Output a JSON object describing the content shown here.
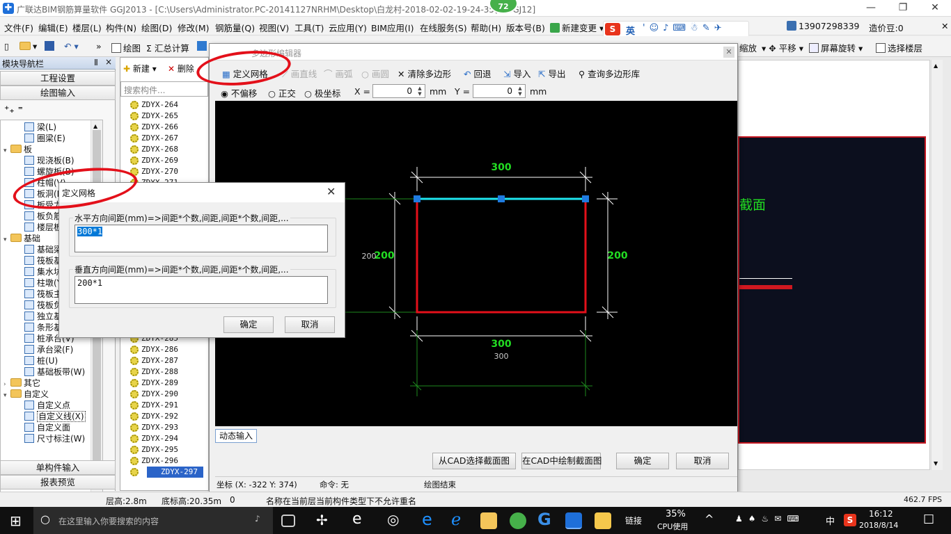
{
  "window": {
    "title": "广联达BIM钢筋算量软件 GGJ2013 - [C:\\Users\\Administrator.PC-20141127NRHM\\Desktop\\白龙村-2018-02-02-19-24-35(        ).GGJ12]",
    "badge": "72",
    "min": "—",
    "restore": "❐",
    "close": "✕"
  },
  "menu": [
    "文件(F)",
    "编辑(E)",
    "楼层(L)",
    "构件(N)",
    "绘图(D)",
    "修改(M)",
    "钢筋量(Q)",
    "视图(V)",
    "工具(T)",
    "云应用(Y)",
    "BIM应用(I)",
    "在线服务(S)",
    "帮助(H)",
    "版本号(B)",
    "新建变更 ▾"
  ],
  "menu_right": {
    "phone": "13907298339",
    "price": "造价豆:0"
  },
  "ime": {
    "label": "英"
  },
  "toolbar": {
    "draw": "绘图",
    "calc": "Σ 汇总计算",
    "scale": "缩放",
    "pan": "平移",
    "rotate": "屏幕旋转",
    "floor": "选择楼层"
  },
  "nav": {
    "header": "模块导航栏",
    "pin": "Ⅱ",
    "close": "×",
    "project": "工程设置",
    "drawing": "绘图输入",
    "single": "单构件输入",
    "report": "报表预览",
    "tree": [
      {
        "label": "梁(L)",
        "level": 2
      },
      {
        "label": "圈梁(E)",
        "level": 2
      },
      {
        "label": "板",
        "level": 1,
        "folder": true,
        "open": true
      },
      {
        "label": "现浇板(B)",
        "level": 2
      },
      {
        "label": "螺旋板(B)",
        "level": 2
      },
      {
        "label": "柱帽(V)",
        "level": 2
      },
      {
        "label": "板洞(N)",
        "level": 2
      },
      {
        "label": "板受力筋(S)",
        "level": 2
      },
      {
        "label": "板负筋(F)",
        "level": 2
      },
      {
        "label": "楼层板带(H)",
        "level": 2
      },
      {
        "label": "基础",
        "level": 1,
        "folder": true,
        "open": true
      },
      {
        "label": "基础梁(F)",
        "level": 2
      },
      {
        "label": "筏板基础(M)",
        "level": 2
      },
      {
        "label": "集水坑(K)",
        "level": 2
      },
      {
        "label": "柱墩(Y)",
        "level": 2
      },
      {
        "label": "筏板主筋(R)",
        "level": 2
      },
      {
        "label": "筏板负筋(X)",
        "level": 2
      },
      {
        "label": "独立基础(P)",
        "level": 2
      },
      {
        "label": "条形基础(T)",
        "level": 2
      },
      {
        "label": "桩承台(V)",
        "level": 2
      },
      {
        "label": "承台梁(F)",
        "level": 2
      },
      {
        "label": "桩(U)",
        "level": 2
      },
      {
        "label": "基础板带(W)",
        "level": 2
      },
      {
        "label": "其它",
        "level": 1,
        "folder": true,
        "open": false
      },
      {
        "label": "自定义",
        "level": 1,
        "folder": true,
        "open": true
      },
      {
        "label": "自定义点",
        "level": 2
      },
      {
        "label": "自定义线(X)",
        "level": 2,
        "selected": true
      },
      {
        "label": "自定义面",
        "level": 2
      },
      {
        "label": "尺寸标注(W)",
        "level": 2
      }
    ]
  },
  "complist": {
    "new": "新建 ▾",
    "delete": "删除",
    "search_placeholder": "搜索构件...",
    "items": [
      "ZDYX-264",
      "ZDYX-265",
      "ZDYX-266",
      "ZDYX-267",
      "ZDYX-268",
      "ZDYX-269",
      "ZDYX-270",
      "ZDYX-271",
      "",
      "",
      "",
      "",
      "",
      "",
      "",
      "",
      "",
      "",
      "",
      "",
      "",
      "ZDYX-285",
      "ZDYX-286",
      "ZDYX-287",
      "ZDYX-288",
      "ZDYX-289",
      "ZDYX-290",
      "ZDYX-291",
      "ZDYX-292",
      "ZDYX-293",
      "ZDYX-294",
      "ZDYX-295",
      "ZDYX-296",
      "ZDYX-297"
    ]
  },
  "mainDialog": {
    "title": "多边形编辑器",
    "tools": {
      "define_grid": "定义网格",
      "line": "画直线",
      "arc": "画弧",
      "circle": "画圆",
      "clear": "清除多边形",
      "undo": "回退",
      "import": "导入",
      "export": "导出",
      "query": "查询多边形库"
    },
    "snap": {
      "none": "不偏移",
      "ortho": "正交",
      "polar": "极坐标",
      "x_label": "X =",
      "x_value": "0",
      "y_label": "Y =",
      "y_value": "0",
      "unit": "mm"
    },
    "dims": {
      "top": "300",
      "bottom": "300",
      "bottom_small": "300",
      "left": "200",
      "left_small": "200",
      "right": "200"
    },
    "dynamic_input": "动态输入",
    "buttons": {
      "from_cad": "从CAD选择截面图",
      "draw_cad": "在CAD中绘制截面图",
      "ok": "确定",
      "cancel": "取消"
    },
    "status": {
      "coord": "坐标 (X: -322 Y: 374)",
      "command": "命令: 无",
      "message": "绘图结束"
    }
  },
  "gridDialog": {
    "title": "定义网格",
    "h_label": "水平方向间距(mm)=>间距*个数,间距,间距*个数,间距,...",
    "h_value": "300*1",
    "v_label": "垂直方向间距(mm)=>间距*个数,间距,间距*个数,间距,...",
    "v_value": "200*1",
    "ok": "确定",
    "cancel": "取消"
  },
  "right_panel": {
    "text": "截面"
  },
  "statusbar": {
    "floor_height": "层高:2.8m",
    "base_height": "底标高:20.35m",
    "zero": "0",
    "message": "名称在当前层当前构件类型下不允许重名",
    "fps": "462.7 FPS"
  },
  "taskbar": {
    "search_placeholder": "在这里输入你要搜索的内容",
    "link": "链接",
    "cpu_pct": "35%",
    "cpu_label": "CPU使用",
    "lang": "中",
    "time": "16:12",
    "date": "2018/8/14"
  },
  "colors": {
    "rect_red": "#e3101a",
    "rect_top": "#1ee6f0",
    "dim_green": "#22dd22",
    "handle": "#1f7be0",
    "annotation": "#e3101a"
  }
}
